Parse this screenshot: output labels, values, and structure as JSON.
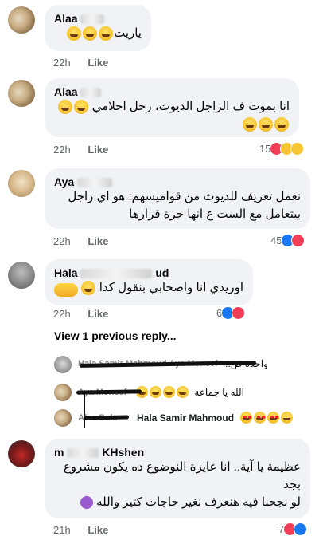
{
  "comments": [
    {
      "name": "Alaa",
      "text": "ياريت",
      "time": "22h",
      "like": "Like",
      "reactions": ""
    },
    {
      "name": "Alaa",
      "text": "انا بموت ف الراجل الديوث، رجل احلامي",
      "time": "22h",
      "like": "Like",
      "reactions": "15"
    },
    {
      "name": "Aya",
      "line1": "نعمل تعريف للديوث من قواميسهم: هو اي راجل",
      "line2": "بيتعامل مع الست ع انها حرة قرارها",
      "time": "22h",
      "like": "Like",
      "reactions": "45"
    },
    {
      "name": "Hala",
      "name2": "ud",
      "text": "اوريدي انا واصحابي بنقول كدا",
      "time": "22h",
      "like": "Like",
      "reactions": "6"
    },
    {
      "name": "m",
      "name2": "KHshen",
      "line1": "عظيمة يا آية.. انا عايزة النوضوع ده يكون مشروع",
      "line2": "بجد",
      "line3": "لو نجحنا فيه هنعرف نغير حاجات كتير والله",
      "time": "21h",
      "like": "Like",
      "reactions": "7"
    }
  ],
  "view_replies": "View 1 previous reply...",
  "replies": [
    {
      "name": "Hala Samir Mahmoud Aya Monsef",
      "text": "واحدة ص..."
    },
    {
      "name": "Aya Monsef",
      "text": "الله يا جماعة"
    },
    {
      "name": "Alaa Bakr",
      "text": "Hala Samir Mahmoud"
    }
  ],
  "colors": {
    "bubble": "#f0f2f5",
    "meta": "#65676b",
    "like_blue": "#1877f2",
    "love_red": "#f33e58",
    "haha_yellow": "#f7c531"
  }
}
